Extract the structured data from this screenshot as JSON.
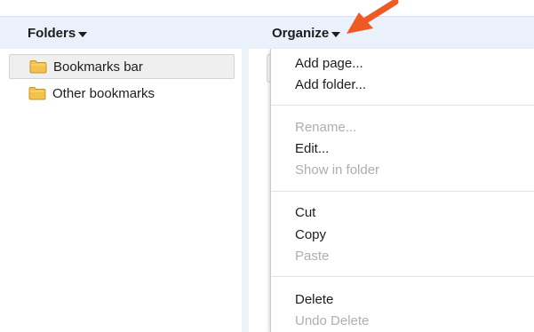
{
  "header": {
    "folders_label": "Folders",
    "organize_label": "Organize"
  },
  "tree": {
    "items": [
      {
        "label": "Bookmarks bar",
        "selected": true
      },
      {
        "label": "Other bookmarks",
        "selected": false
      }
    ]
  },
  "organize_menu": {
    "items": [
      {
        "label": "Add page...",
        "enabled": true
      },
      {
        "label": "Add folder...",
        "enabled": true
      },
      {
        "label": "Rename...",
        "enabled": false
      },
      {
        "label": "Edit...",
        "enabled": true
      },
      {
        "label": "Show in folder",
        "enabled": false
      },
      {
        "label": "Cut",
        "enabled": true
      },
      {
        "label": "Copy",
        "enabled": true
      },
      {
        "label": "Paste",
        "enabled": false
      },
      {
        "label": "Delete",
        "enabled": true
      },
      {
        "label": "Undo Delete",
        "enabled": false
      }
    ]
  },
  "colors": {
    "header_bg": "#eaf1fb",
    "folder_icon": "#f2c24b",
    "annotation_arrow": "#ef5a24",
    "disabled_text": "#aeaeae"
  },
  "icons": {
    "folder": "folder-icon",
    "caret": "caret-down-icon",
    "annotation": "arrow-annotation-icon"
  }
}
